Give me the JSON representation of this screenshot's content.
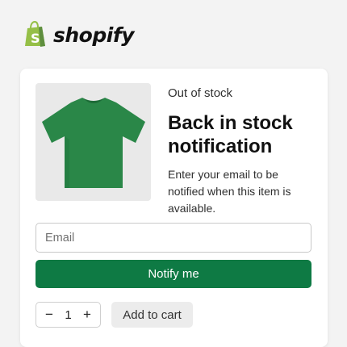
{
  "brand": {
    "name": "shopify",
    "icon": "shopify-bag-icon",
    "color": "#95bf47"
  },
  "product": {
    "image_icon": "green-tshirt-icon",
    "shirt_color": "#2a8748",
    "status": "Out of stock",
    "title": "Back in stock notification",
    "description": "Enter your email to be notified when this item is available."
  },
  "form": {
    "email_placeholder": "Email",
    "email_value": "",
    "notify_label": "Notify me",
    "notify_color": "#0e7a44"
  },
  "cart": {
    "decrement_label": "−",
    "quantity": "1",
    "increment_label": "+",
    "add_to_cart_label": "Add to cart"
  }
}
